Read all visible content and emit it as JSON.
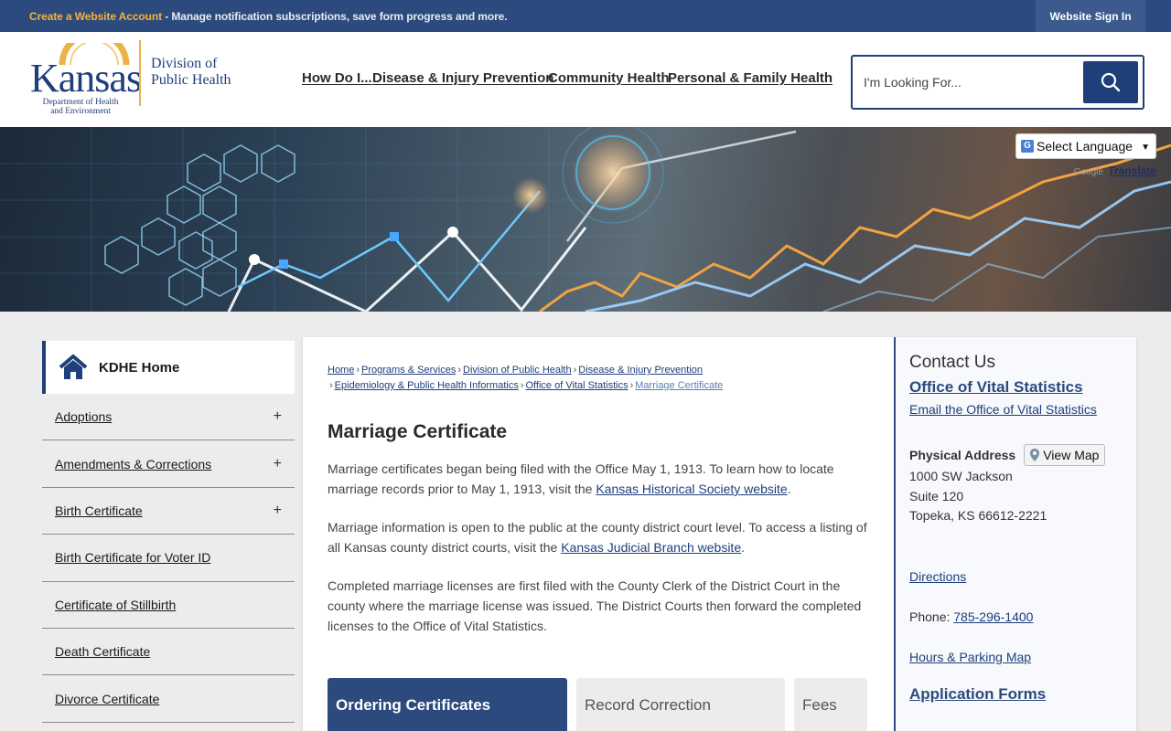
{
  "topbar": {
    "create_account": "Create a Website Account",
    "message": " - Manage notification subscriptions, save form progress and more.",
    "signin": "Website Sign In"
  },
  "logo": {
    "name": "Kansas",
    "dept_line1": "Department of Health",
    "dept_line2": "and Environment",
    "division_line1": "Division of",
    "division_line2": "Public Health"
  },
  "nav": [
    "How Do I...",
    "Disease & Injury Prevention",
    "Community Health",
    "Personal & Family Health"
  ],
  "search": {
    "placeholder": "I'm Looking For..."
  },
  "translate": {
    "select": "Select Language",
    "google": "Google",
    "translate": "Translate"
  },
  "sidebar": {
    "home": "KDHE Home",
    "items": [
      {
        "label": "Adoptions",
        "expandable": true
      },
      {
        "label": "Amendments & Corrections",
        "expandable": true
      },
      {
        "label": "Birth Certificate",
        "expandable": true
      },
      {
        "label": "Birth Certificate for Voter ID",
        "expandable": false
      },
      {
        "label": "Certificate of Stillbirth",
        "expandable": false
      },
      {
        "label": "Death Certificate",
        "expandable": false
      },
      {
        "label": "Divorce Certificate",
        "expandable": false
      }
    ]
  },
  "breadcrumb": {
    "items": [
      "Home",
      "Programs & Services",
      "Division of Public Health",
      "Disease & Injury Prevention",
      "Epidemiology & Public Health Informatics",
      "Office of Vital Statistics"
    ],
    "current": "Marriage Certificate"
  },
  "page": {
    "title": "Marriage Certificate",
    "p1_before": "Marriage certificates began being filed with the Office May 1, 1913. To learn how to locate marriage records prior to May 1, 1913, visit the ",
    "p1_link": "Kansas Historical Society website",
    "p1_after": ".",
    "p2_before": "Marriage information is open to the public at the county district court level. To access a listing of all Kansas county district courts, visit the ",
    "p2_link": "Kansas Judicial Branch website",
    "p2_after": ".",
    "p3": "Completed marriage licenses are first filed with the County Clerk of the District Court in the county where the marriage license was issued. The District Courts then forward the completed licenses to the Office of Vital Statistics."
  },
  "tabs": [
    "Ordering Certificates",
    "Record Correction",
    "Fees"
  ],
  "contact": {
    "title": "Contact Us",
    "office": "Office of Vital Statistics",
    "email": "Email the Office of Vital Statistics",
    "address_label": "Physical Address",
    "view_map": "View Map",
    "address": [
      "1000 SW Jackson",
      "Suite 120",
      "Topeka, KS 66612-2221"
    ],
    "directions": "Directions",
    "phone_label": "Phone: ",
    "phone": "785-296-1400",
    "hours": "Hours & Parking Map",
    "forms": "Application Forms"
  }
}
